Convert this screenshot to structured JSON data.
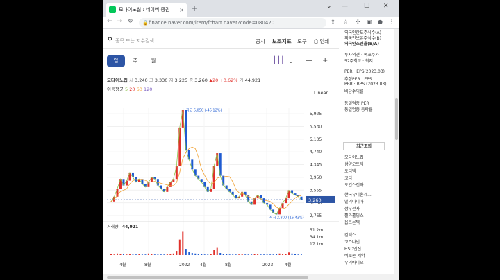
{
  "browser": {
    "tab_title": "모다이노칩 : 네이버 증권",
    "tab_close": "×",
    "new_tab": "+",
    "url": "finance.naver.com/item/fchart.naver?code=080420"
  },
  "toolbar": {
    "search_placeholder": "종목 또는 지수검색",
    "items": [
      "공시",
      "보조지표",
      "도구",
      "인쇄"
    ]
  },
  "periods": [
    "일",
    "주",
    "월"
  ],
  "quote": {
    "name": "모다이노칩",
    "open_label": "시",
    "open": "3,240",
    "high_label": "고",
    "high": "3,330",
    "low_label": "저",
    "low": "3,225",
    "close_label": "종",
    "close": "3,260",
    "change": "▲20 +0.62%",
    "volume_label": "거",
    "volume": "44,921"
  },
  "ma": {
    "label": "이동평균",
    "p5": "5",
    "p20": "20",
    "p60": "60",
    "p120": "120"
  },
  "scale_mode": "Linear",
  "chart_data": {
    "type": "line",
    "price_ticks": [
      "5,925",
      "5,530",
      "5,135",
      "4,740",
      "4,345",
      "3,950",
      "3,555",
      "3,160",
      "2,765"
    ],
    "x_ticks": [
      "4월",
      "8월",
      "2022",
      "4월",
      "8월",
      "2023",
      "4월"
    ],
    "current_price": "3,260",
    "high_annotation": "최고 6,050 (-46.12%)",
    "low_annotation": "최저 2,800 (16.43%)",
    "volume_label": "거래량",
    "volume": "44,921",
    "volume_ticks": [
      "51.2m",
      "34.1m",
      "17.1m"
    ],
    "price_series": [
      3200,
      3350,
      3600,
      3900,
      3700,
      3850,
      4100,
      3950,
      3800,
      3900,
      3750,
      3650,
      3800,
      3950,
      3900,
      3700,
      3600,
      3500,
      3650,
      3800,
      3900,
      4300,
      5500,
      6050,
      4800,
      4500,
      4200,
      4000,
      3900,
      3800,
      3650,
      3500,
      3600,
      4300,
      4700,
      4000,
      3700,
      3600,
      3500,
      3400,
      3300,
      3350,
      3500,
      3400,
      3200,
      3100,
      3300,
      3400,
      3300,
      3150,
      3100,
      2950,
      2850,
      2800,
      3000,
      3150,
      3300,
      3550,
      3450,
      3400,
      3350,
      3260
    ],
    "volume_series": [
      2,
      1,
      3,
      2,
      2,
      1,
      2,
      1,
      1,
      2,
      1,
      1,
      3,
      2,
      1,
      1,
      1,
      1,
      2,
      2,
      3,
      8,
      30,
      45,
      12,
      6,
      4,
      3,
      2,
      2,
      1,
      1,
      2,
      10,
      14,
      4,
      2,
      2,
      1,
      1,
      1,
      1,
      2,
      1,
      1,
      1,
      2,
      2,
      1,
      1,
      1,
      1,
      1,
      2,
      3,
      2,
      2,
      5,
      3,
      2,
      1,
      1
    ]
  },
  "right_sidebar": {
    "top_lines": [
      "외국인한도주식수(A)",
      "외국인보유주식수(B)",
      "외국인소진율(B/A)"
    ],
    "mid_lines": [
      "투자의견 · 목표주가",
      "52주최고 · 최저"
    ],
    "per_lines": [
      "PER · EPS(2023.03)",
      "추정PER · EPS",
      "PBR · BPS (2023.03)",
      "배당수익률"
    ],
    "industry_lines": [
      "동일업종 PER",
      "동일업종 등락률"
    ],
    "recent_header": "최근조회",
    "recent": [
      "모다이노칩",
      "삼양오토텍",
      "오디텍",
      "코디",
      "오킨스전자",
      "한국유니온제...",
      "빌리다이아",
      "삼우전자",
      "휠라홀딩스",
      "옵트론텍",
      "켐텍스",
      "코스나인",
      "HSD엔진",
      "비보존 제약",
      "우리바이오"
    ]
  }
}
